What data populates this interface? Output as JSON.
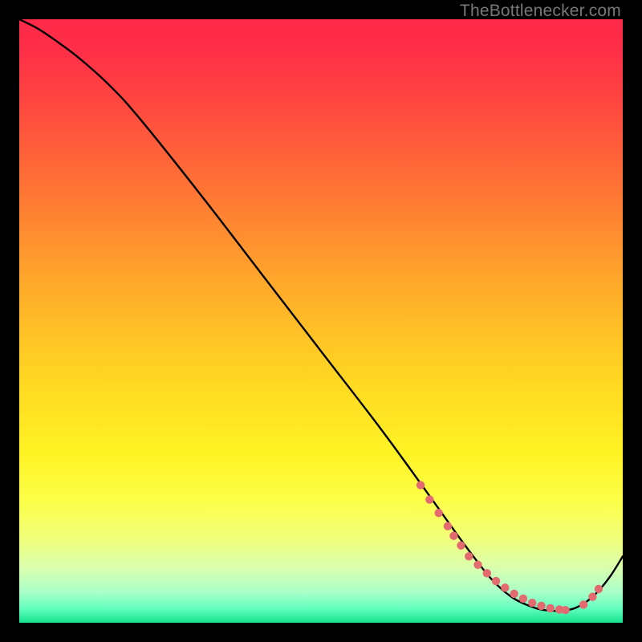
{
  "watermark": "TheBottlenecker.com",
  "chart_data": {
    "type": "line",
    "title": "",
    "xlabel": "",
    "ylabel": "",
    "xlim": [
      0,
      100
    ],
    "ylim": [
      0,
      100
    ],
    "grid": false,
    "gradient_stops": [
      {
        "offset": 0.0,
        "color": "#ff2a49"
      },
      {
        "offset": 0.05,
        "color": "#ff2e48"
      },
      {
        "offset": 0.15,
        "color": "#ff4a3f"
      },
      {
        "offset": 0.3,
        "color": "#ff7a33"
      },
      {
        "offset": 0.45,
        "color": "#ffad2a"
      },
      {
        "offset": 0.6,
        "color": "#ffd822"
      },
      {
        "offset": 0.72,
        "color": "#fff324"
      },
      {
        "offset": 0.8,
        "color": "#fcff4a"
      },
      {
        "offset": 0.86,
        "color": "#f1ff7a"
      },
      {
        "offset": 0.91,
        "color": "#d9ffaf"
      },
      {
        "offset": 0.95,
        "color": "#a8ffc8"
      },
      {
        "offset": 0.975,
        "color": "#66ffbf"
      },
      {
        "offset": 1.0,
        "color": "#17e38f"
      }
    ],
    "series": [
      {
        "name": "curve",
        "color": "#000000",
        "x": [
          0,
          3,
          6,
          10,
          15,
          20,
          30,
          40,
          50,
          60,
          68,
          73,
          76,
          78,
          80,
          82,
          84,
          86,
          88,
          90,
          92,
          94,
          96,
          98,
          100
        ],
        "y": [
          100,
          98.5,
          96.5,
          93.5,
          89,
          83.5,
          71,
          58,
          45,
          32,
          21,
          14,
          10,
          7.5,
          5.5,
          4,
          3,
          2.3,
          2,
          2,
          2.4,
          3.5,
          5.3,
          7.8,
          11
        ]
      }
    ],
    "dotted_overlay": {
      "color": "#e36a6f",
      "radius": 5.2,
      "points_x": [
        66.5,
        68,
        69.5,
        71,
        72,
        73.2,
        74.5,
        76,
        77.5,
        79,
        80.5,
        82,
        83.5,
        85,
        86.5,
        88,
        89.5,
        90.5,
        93.5,
        95,
        96
      ],
      "points_y": [
        22.8,
        20.4,
        18.2,
        16.0,
        14.4,
        12.8,
        11.0,
        9.6,
        8.2,
        6.9,
        5.8,
        4.8,
        4.0,
        3.3,
        2.8,
        2.4,
        2.2,
        2.1,
        3.0,
        4.3,
        5.6
      ]
    }
  }
}
